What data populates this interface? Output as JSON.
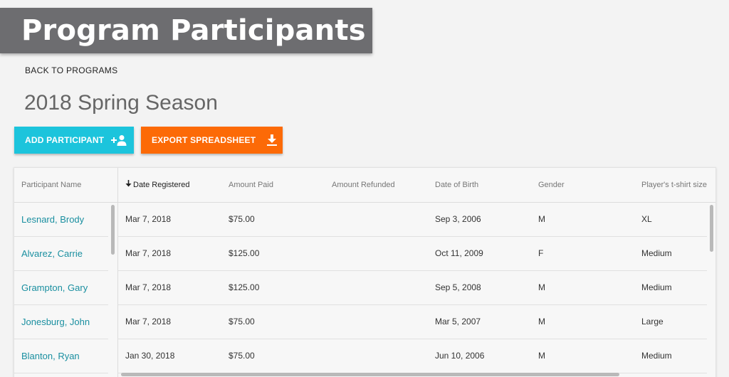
{
  "header": {
    "title": "Program Participants"
  },
  "nav": {
    "back_label": "BACK TO PROGRAMS"
  },
  "program": {
    "season": "2018 Spring Season"
  },
  "actions": {
    "add_label": "ADD PARTICIPANT",
    "export_label": "EXPORT SPREADSHEET",
    "add_color": "#1cc4dc",
    "export_color": "#fc6a07"
  },
  "table": {
    "frozen_header": "Participant Name",
    "columns": [
      "Date Registered",
      "Amount Paid",
      "Amount Refunded",
      "Date of Birth",
      "Gender",
      "Player's t-shirt size"
    ],
    "sort_column": "Date Registered",
    "sort_direction": "descending",
    "rows": [
      {
        "name": "Lesnard, Brody",
        "cells": [
          "Mar 7, 2018",
          "$75.00",
          "",
          "Sep 3, 2006",
          "M",
          "XL"
        ]
      },
      {
        "name": "Alvarez, Carrie",
        "cells": [
          "Mar 7, 2018",
          "$125.00",
          "",
          "Oct 11, 2009",
          "F",
          "Medium"
        ]
      },
      {
        "name": "Grampton, Gary",
        "cells": [
          "Mar 7, 2018",
          "$125.00",
          "",
          "Sep 5, 2008",
          "M",
          "Medium"
        ]
      },
      {
        "name": "Jonesburg, John",
        "cells": [
          "Mar 7, 2018",
          "$75.00",
          "",
          "Mar 5, 2007",
          "M",
          "Large"
        ]
      },
      {
        "name": "Blanton, Ryan",
        "cells": [
          "Jan 30, 2018",
          "$75.00",
          "",
          "Jun 10, 2006",
          "M",
          "Medium"
        ]
      }
    ],
    "link_color": "#1a8fa0"
  }
}
